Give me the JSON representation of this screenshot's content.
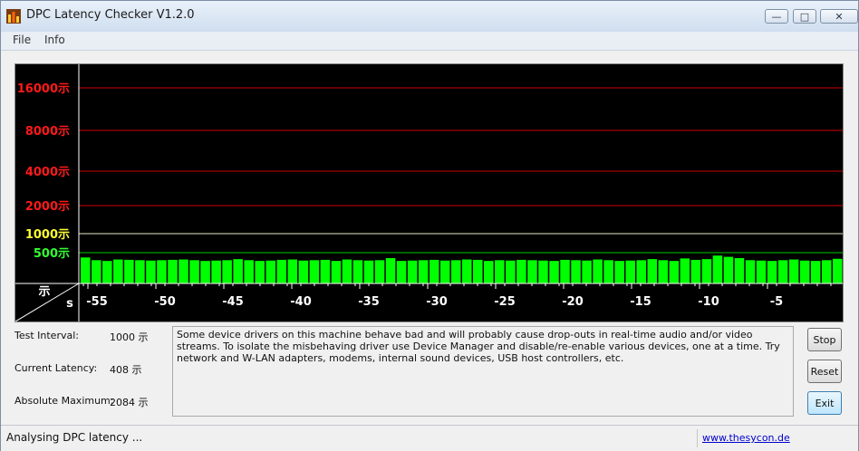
{
  "window": {
    "title": "DPC Latency Checker V1.2.0",
    "minimize_glyph": "—",
    "maximize_glyph": "□",
    "close_glyph": "✕"
  },
  "menu": {
    "items": [
      "File",
      "Info"
    ]
  },
  "chart_data": {
    "type": "bar",
    "y_labels": [
      {
        "text": "16000示",
        "color": "#ff1a1a"
      },
      {
        "text": "8000示",
        "color": "#ff1a1a"
      },
      {
        "text": "4000示",
        "color": "#ff1a1a"
      },
      {
        "text": "2000示",
        "color": "#ff1a1a"
      },
      {
        "text": "1000示",
        "color": "#ffff33"
      },
      {
        "text": "500示",
        "color": "#33ff33"
      }
    ],
    "threshold_colors": [
      "#cc0000",
      "#cc0000",
      "#cc0000",
      "#cc0000",
      "#e8e8c8",
      "#00cc00"
    ],
    "x_ticks": [
      "-55",
      "-50",
      "-45",
      "-40",
      "-35",
      "-30",
      "-25",
      "-20",
      "-15",
      "-10",
      "-5"
    ],
    "x_unit": "s",
    "y_unit": "示",
    "bar_color": "#00ff00",
    "values": [
      420,
      380,
      370,
      390,
      385,
      380,
      375,
      380,
      385,
      390,
      380,
      370,
      375,
      380,
      395,
      380,
      370,
      375,
      385,
      390,
      375,
      380,
      385,
      370,
      390,
      380,
      375,
      380,
      410,
      370,
      375,
      380,
      385,
      375,
      380,
      390,
      385,
      370,
      380,
      375,
      385,
      380,
      375,
      370,
      385,
      380,
      375,
      390,
      380,
      370,
      375,
      380,
      395,
      380,
      370,
      405,
      385,
      395,
      450,
      430,
      410,
      380,
      375,
      370,
      380,
      390,
      375,
      370,
      380,
      400
    ]
  },
  "info": {
    "test_interval_label": "Test Interval:",
    "test_interval_value": "1000 示",
    "current_latency_label": "Current Latency:",
    "current_latency_value": "408 示",
    "absolute_max_label": "Absolute Maximum:",
    "absolute_max_value": "2084 示"
  },
  "message": "Some device drivers on this machine behave bad and will probably cause drop-outs in real-time audio and/or video streams. To isolate the misbehaving driver use Device Manager and disable/re-enable various devices, one at a time. Try network and W-LAN adapters, modems, internal sound devices, USB host controllers, etc.",
  "buttons": {
    "stop": "Stop",
    "reset": "Reset",
    "exit": "Exit"
  },
  "status": {
    "text": "Analysing DPC latency ...",
    "link": "www.thesycon.de"
  }
}
